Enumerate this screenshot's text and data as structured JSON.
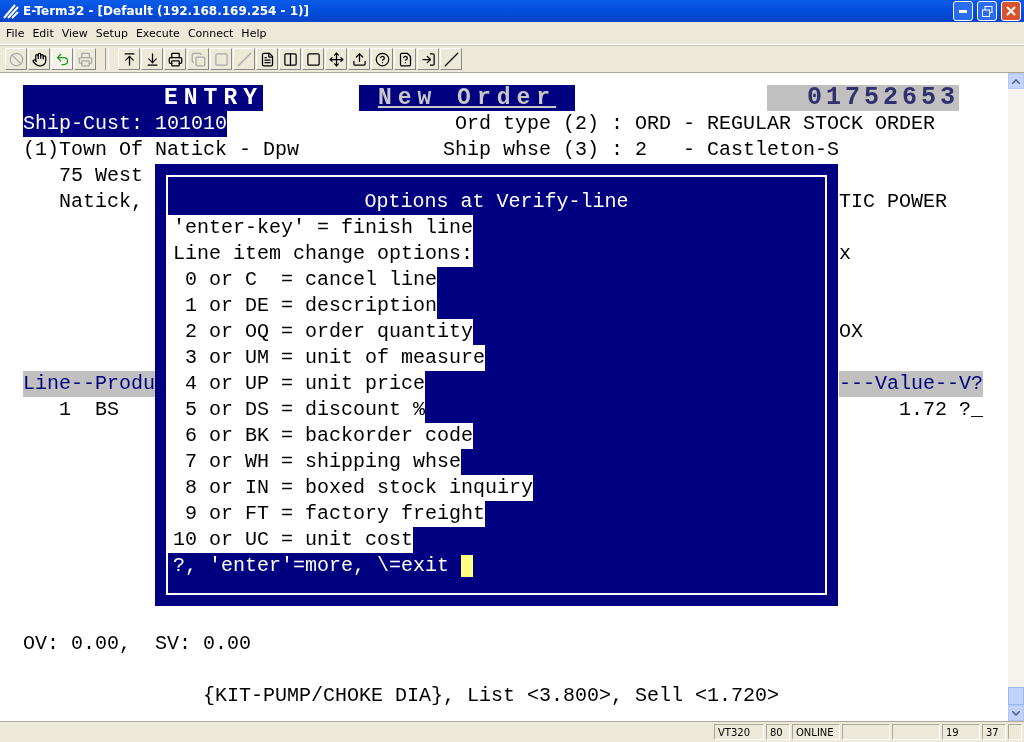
{
  "window": {
    "title": "E-Term32 - [Default (192.168.169.254 - 1)]"
  },
  "menu": [
    "File",
    "Edit",
    "View",
    "Setup",
    "Execute",
    "Connect",
    "Help"
  ],
  "terminal": {
    "lines": [
      {
        "segments": [
          "ENTRY",
          "New Order",
          "01752653"
        ]
      },
      {
        "segments": [
          "Ship-Cust:",
          "101010",
          "Ord type (2) : ORD - REGULAR STOCK ORDER"
        ]
      },
      {
        "segments": [
          "(1)Town Of Natick - Dpw",
          "Ship whse (3) : 2   - Castleton-S"
        ]
      },
      {
        "segments": [
          "75 West"
        ]
      },
      {
        "segments": [
          "Natick,",
          "TIC POWER"
        ]
      },
      {
        "segments": [
          "x"
        ]
      },
      {
        "segments": [
          "OX"
        ]
      },
      {
        "segments": [
          "Line--Produ",
          "---Value--V?"
        ]
      },
      {
        "segments": [
          "1",
          "BS",
          "1.72 ?_"
        ]
      },
      {
        "segments": [
          "OV: 0.00,  SV: 0.00"
        ]
      },
      {
        "segments": [
          "{KIT-PUMP/CHOKE DIA}, List <3.800>, Sell <1.720>"
        ]
      }
    ]
  },
  "dialog": {
    "title": "Options at Verify-line",
    "lines": [
      {
        "text": "'enter-key' = finish line",
        "kind": "option"
      },
      {
        "text": "Line item change options:",
        "kind": "option"
      },
      {
        "text": " 0 or C  = cancel line",
        "kind": "option"
      },
      {
        "text": " 1 or DE = description",
        "kind": "option"
      },
      {
        "text": " 2 or OQ = order quantity",
        "kind": "option"
      },
      {
        "text": " 3 or UM = unit of measure",
        "kind": "option"
      },
      {
        "text": " 4 or UP = unit price",
        "kind": "option"
      },
      {
        "text": " 5 or DS = discount %",
        "kind": "option"
      },
      {
        "text": " 6 or BK = backorder code",
        "kind": "option"
      },
      {
        "text": " 7 or WH = shipping whse",
        "kind": "option"
      },
      {
        "text": " 8 or IN = boxed stock inquiry",
        "kind": "option"
      },
      {
        "text": " 9 or FT = factory freight",
        "kind": "option"
      },
      {
        "text": "10 or UC = unit cost",
        "kind": "option"
      },
      {
        "text": "?, 'enter'=more, \\=exit",
        "kind": "prompt"
      }
    ]
  },
  "status_bar": [
    "VT320",
    "80",
    "ONLINE",
    "19",
    "37"
  ]
}
